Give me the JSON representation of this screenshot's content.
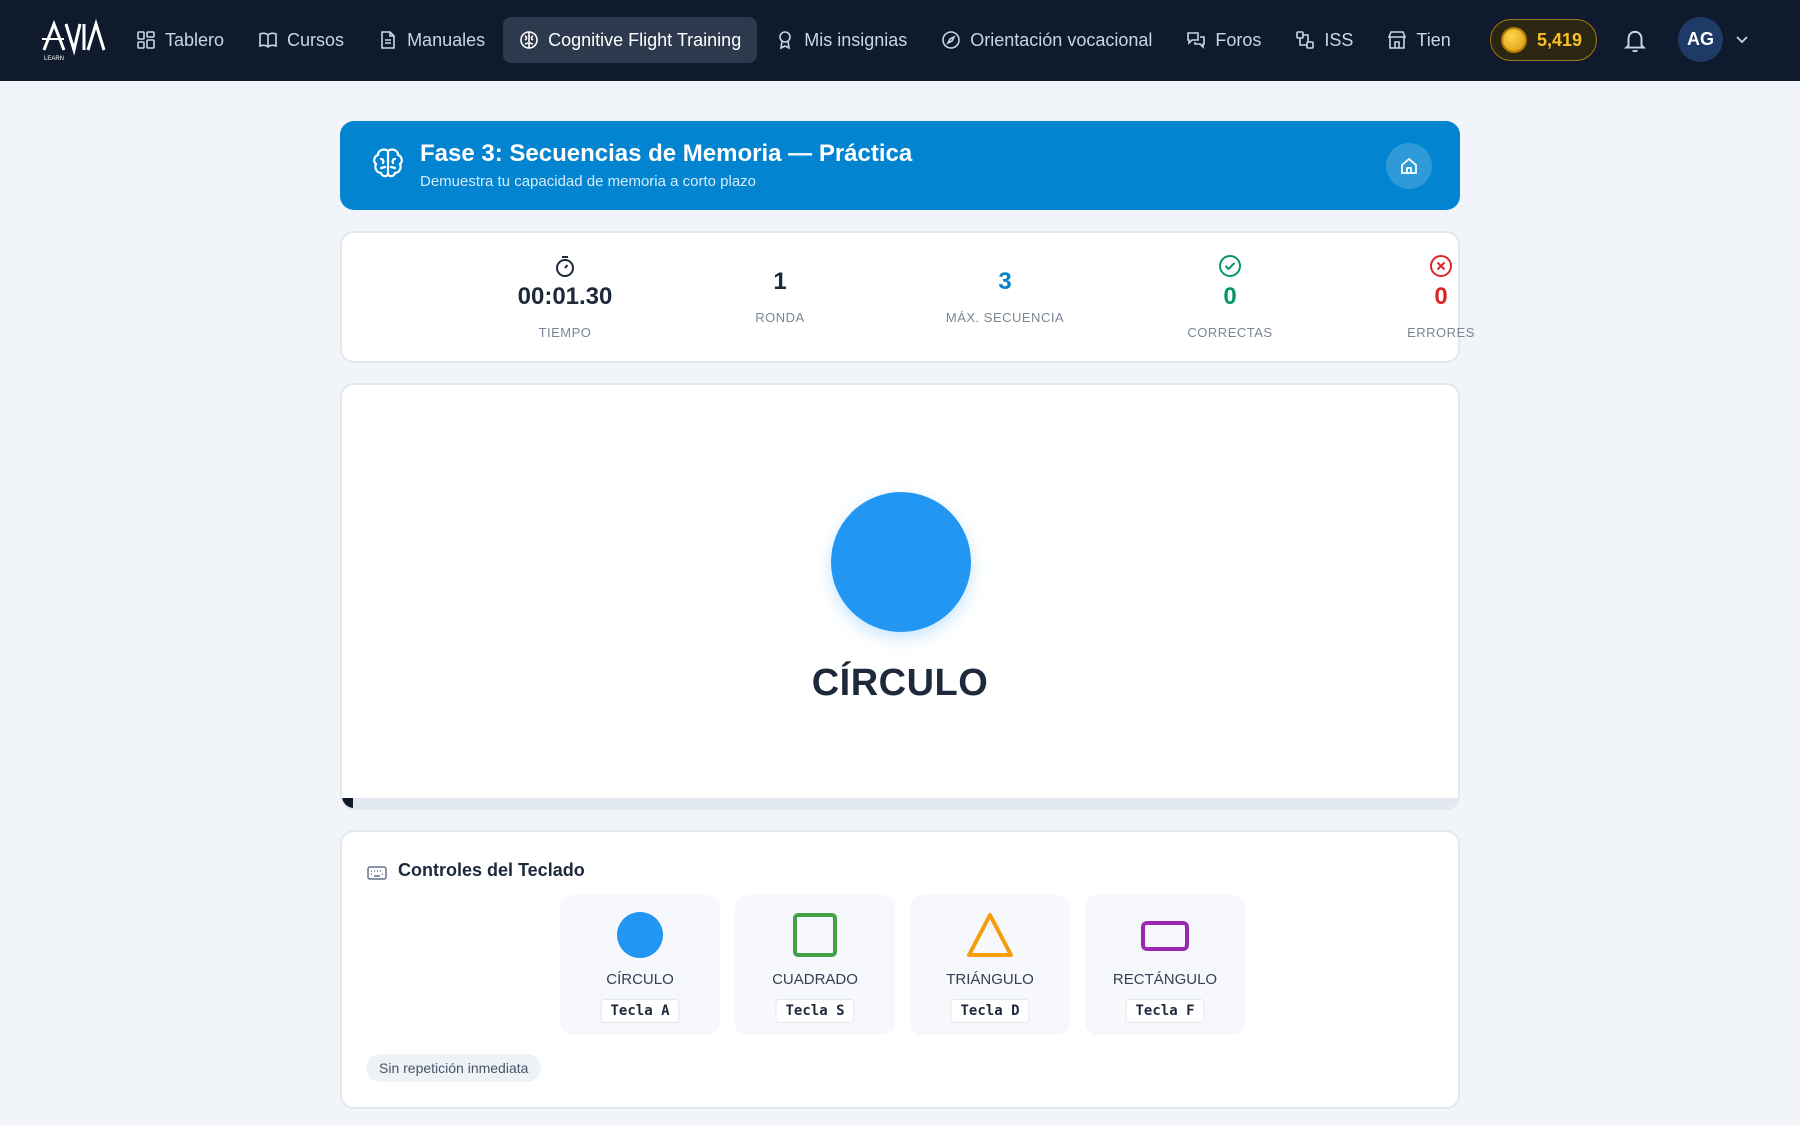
{
  "nav": {
    "items": [
      {
        "label": "Tablero",
        "icon": "dashboard-icon"
      },
      {
        "label": "Cursos",
        "icon": "book-icon"
      },
      {
        "label": "Manuales",
        "icon": "document-icon"
      },
      {
        "label": "Cognitive Flight Training",
        "icon": "brain-icon",
        "active": true
      },
      {
        "label": "Mis insignias",
        "icon": "badge-icon"
      },
      {
        "label": "Orientación vocacional",
        "icon": "compass-icon"
      },
      {
        "label": "Foros",
        "icon": "chat-icon"
      },
      {
        "label": "ISS",
        "icon": "network-icon"
      },
      {
        "label": "Tien",
        "icon": "store-icon"
      }
    ],
    "coins": "5,419",
    "avatar": "AG"
  },
  "header": {
    "title": "Fase 3: Secuencias de Memoria — Práctica",
    "subtitle": "Demuestra tu capacidad de memoria a corto plazo"
  },
  "stats": {
    "time": {
      "value": "00:01.30",
      "label": "TIEMPO"
    },
    "round": {
      "value": "1",
      "label": "RONDA"
    },
    "max_sequence": {
      "value": "3",
      "label": "MÁX. SECUENCIA"
    },
    "correct": {
      "value": "0",
      "label": "CORRECTAS"
    },
    "errors": {
      "value": "0",
      "label": "ERRORES"
    }
  },
  "stage": {
    "current_shape": "CÍRCULO",
    "shape_color": "#2196f3",
    "progress": 0.01
  },
  "keyboard": {
    "title": "Controles del Teclado",
    "keys": [
      {
        "label": "CÍRCULO",
        "key": "Tecla A",
        "color": "#2196f3",
        "shape": "circle"
      },
      {
        "label": "CUADRADO",
        "key": "Tecla S",
        "color": "#43a047",
        "shape": "square"
      },
      {
        "label": "TRIÁNGULO",
        "key": "Tecla D",
        "color": "#f59e0b",
        "shape": "triangle"
      },
      {
        "label": "RECTÁNGULO",
        "key": "Tecla F",
        "color": "#9c27b0",
        "shape": "rectangle"
      }
    ],
    "rule": "Sin repetición inmediata"
  },
  "colors": {
    "navbar": "#0f1b2d",
    "header": "#0284d0",
    "stat_blue": "#0284c7",
    "stat_green": "#059669",
    "stat_red": "#dc2626"
  }
}
